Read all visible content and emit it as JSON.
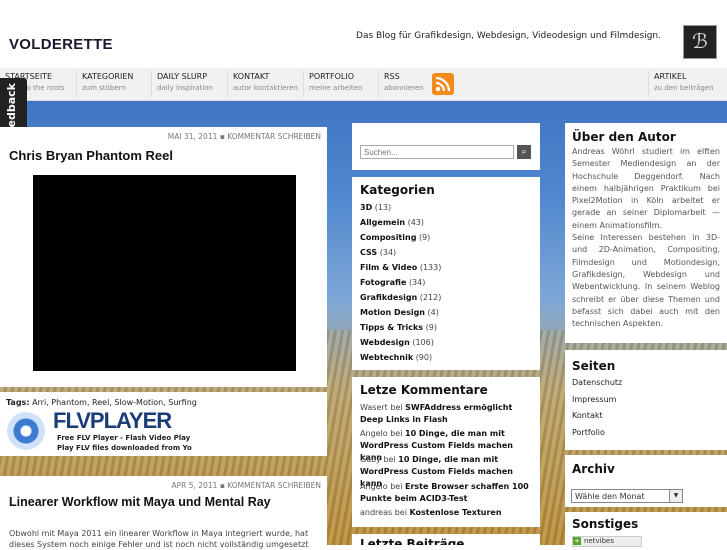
{
  "site": {
    "logo": "VOLDERETTE",
    "tagline": "Das Blog für Grafikdesign, Webdesign, Videodesign und Filmdesign.",
    "avatar_glyph": "ℬ"
  },
  "nav": [
    {
      "title": "STARTSEITE",
      "sub": "back to the roots"
    },
    {
      "title": "KATEGORIEN",
      "sub": "zum stöbern"
    },
    {
      "title": "DAILY SLURP",
      "sub": "daily inspiration"
    },
    {
      "title": "KONTAKT",
      "sub": "autor kontaktieren"
    },
    {
      "title": "PORTFOLIO",
      "sub": "meine arbeiten"
    },
    {
      "title": "RSS",
      "sub": "abonnieren"
    },
    {
      "title": "ARTIKEL",
      "sub": "zu den beiträgen"
    }
  ],
  "feedback": "Feedback",
  "post1": {
    "date": "MAI 31, 2011",
    "comment_link": "KOMMENTAR SCHREIBEN",
    "title": "Chris Bryan Phantom Reel",
    "tags_label": "Tags:",
    "tags": "Arri, Phantom, Reel, Slow-Motion, Surfing"
  },
  "flv": {
    "name": "FLVPLAYER",
    "line1": "Free FLV Player - Flash Video Play",
    "line2": "Play FLV files downloaded from Yo"
  },
  "post2": {
    "date": "APR 5, 2011",
    "comment_link": "KOMMENTAR SCHREIBEN",
    "title": "Linearer Workflow mit Maya und Mental Ray",
    "excerpt": "Obwohl mit Maya 2011 ein linearer Workflow in Maya integriert wurde, hat dieses System noch einige Fehler und ist noch nicht vollständig umgesetzt"
  },
  "search": {
    "placeholder": "Suchen..."
  },
  "categories": {
    "heading": "Kategorien",
    "items": [
      {
        "name": "3D",
        "count": "(13)"
      },
      {
        "name": "Allgemein",
        "count": "(43)"
      },
      {
        "name": "Compositing",
        "count": "(9)"
      },
      {
        "name": "CSS",
        "count": "(34)"
      },
      {
        "name": "Film & Video",
        "count": "(133)"
      },
      {
        "name": "Fotografie",
        "count": "(34)"
      },
      {
        "name": "Grafikdesign",
        "count": "(212)"
      },
      {
        "name": "Motion Design",
        "count": "(4)"
      },
      {
        "name": "Tipps & Tricks",
        "count": "(9)"
      },
      {
        "name": "Webdesign",
        "count": "(106)"
      },
      {
        "name": "Webtechnik",
        "count": "(90)"
      }
    ]
  },
  "comments": {
    "heading": "Letze Kommentare",
    "items": [
      {
        "author": "Wasert",
        "by": "bei",
        "post": "SWFAddress ermöglicht Deep Links in Flash"
      },
      {
        "author": "Angelo",
        "by": "bei",
        "post": "10 Dinge, die man mit WordPress Custom Fields machen kann"
      },
      {
        "author": "Gaby",
        "by": "bei",
        "post": "10 Dinge, die man mit WordPress Custom Fields machen kann"
      },
      {
        "author": "Angelo",
        "by": "bei",
        "post": "Erste Browser schaffen 100 Punkte beim ACID3-Test"
      },
      {
        "author": "andreas",
        "by": "bei",
        "post": "Kostenlose Texturen"
      }
    ],
    "next_heading": "Letzte Beiträge"
  },
  "about": {
    "heading": "Über den Autor",
    "text": "Andreas Wöhrl studiert im elften Semester Mediendesign an der Hochschule Deggendorf. Nach einem halbjährigen Praktikum bei Pixel2Motion in Köln arbeitet er gerade an seiner Diplomarbeit — einem Animationsfilm.",
    "text2": "Seine Interessen bestehen in 3D- und 2D-Animation, Compositing, Filmdesign und Motiondesign, Grafikdesign, Webdesign und Webentwicklung. In seinem Weblog schreibt er über diese Themen und befasst sich dabei auch mit den technischen Aspekten."
  },
  "pages": {
    "heading": "Seiten",
    "items": [
      "Datenschutz",
      "Impressum",
      "Kontakt",
      "Portfolio"
    ]
  },
  "archive": {
    "heading": "Archiv",
    "select_value": "Wähle den Monat"
  },
  "misc": {
    "heading": "Sonstiges",
    "badge": "netvibes"
  }
}
